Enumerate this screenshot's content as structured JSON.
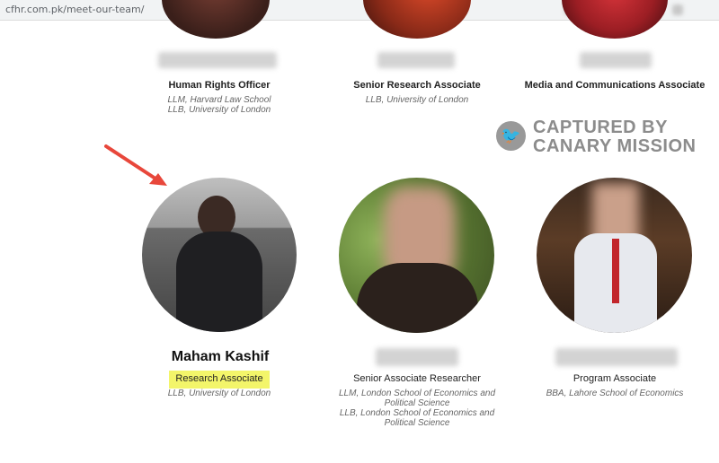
{
  "browser": {
    "url": "cfhr.com.pk/meet-our-team/"
  },
  "watermark": {
    "line1": "CAPTURED BY",
    "line2": "CANARY MISSION",
    "logo_icon": "canary-bird-icon"
  },
  "team_top": [
    {
      "title": "Human Rights Officer",
      "education": [
        "LLM, Harvard Law School",
        "LLB, University of London"
      ]
    },
    {
      "title": "Senior Research Associate",
      "education": [
        "LLB, University of London"
      ]
    },
    {
      "title": "Media and Communications Associate",
      "education": []
    }
  ],
  "team_bottom": [
    {
      "name": "Maham Kashif",
      "title": "Research Associate",
      "education": [
        "LLB, University of London"
      ],
      "highlight_color": "#f3f56a"
    },
    {
      "title": "Senior Associate Researcher",
      "education": [
        "LLM, London School of Economics and",
        "Political Science",
        "LLB, London School of Economics and",
        "Political Science"
      ]
    },
    {
      "title": "Program Associate",
      "education": [
        "BBA, Lahore School of Economics"
      ]
    }
  ],
  "annotation": {
    "arrow_color": "#e8473b"
  }
}
